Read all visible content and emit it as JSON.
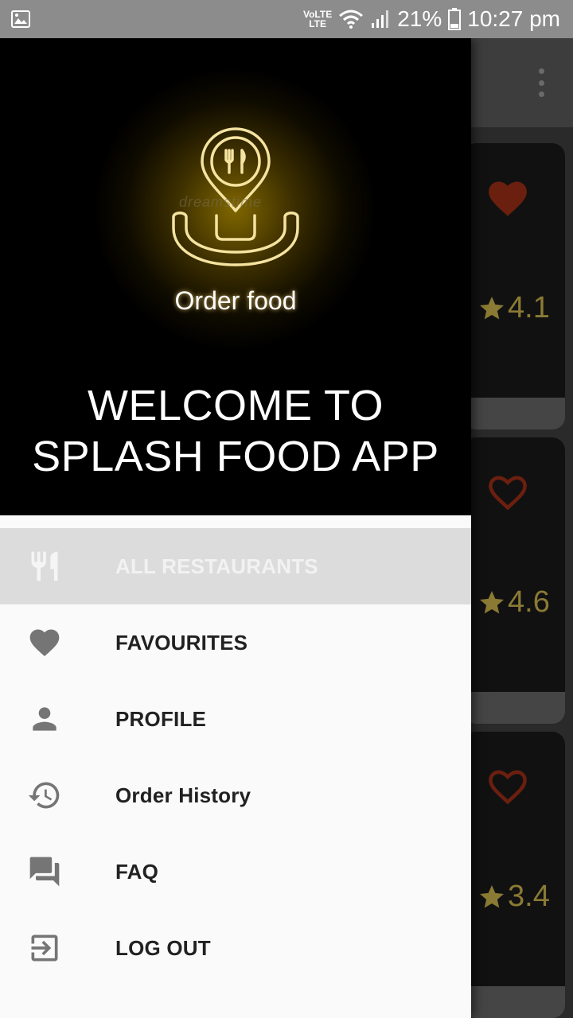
{
  "status_bar": {
    "network": "VoLTE",
    "lte": "LTE",
    "battery": "21%",
    "time": "10:27 pm"
  },
  "drawer": {
    "logo_text": "Order food",
    "watermark": "dreamstime",
    "welcome_line1": "WELCOME TO",
    "welcome_line2": "SPLASH FOOD APP",
    "items": [
      {
        "label": "ALL RESTAURANTS",
        "icon": "restaurant-icon",
        "selected": true
      },
      {
        "label": "FAVOURITES",
        "icon": "heart-icon"
      },
      {
        "label": "PROFILE",
        "icon": "person-icon"
      },
      {
        "label": "Order History",
        "icon": "history-icon"
      },
      {
        "label": "FAQ",
        "icon": "forum-icon"
      },
      {
        "label": "LOG OUT",
        "icon": "logout-icon"
      }
    ]
  },
  "background_list": {
    "cards": [
      {
        "rating": "4.1",
        "favourite": true
      },
      {
        "rating": "4.6",
        "favourite": false
      },
      {
        "rating": "3.4",
        "favourite": false
      }
    ]
  },
  "colors": {
    "accent_selected_bg": "#dcdcdc",
    "rating_gold": "#8a7a34",
    "heart_red": "#6b1f0f",
    "logo_gold": "#f5e3a0"
  }
}
